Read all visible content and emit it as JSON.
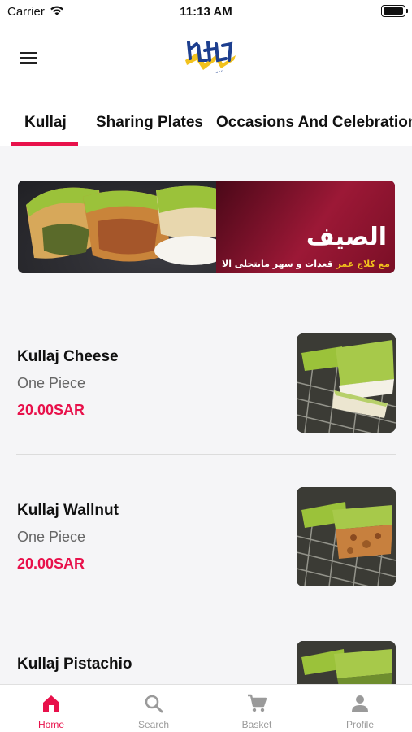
{
  "status_bar": {
    "carrier": "Carrier",
    "time": "11:13 AM"
  },
  "header": {
    "logo_alt": "كلاج عمر"
  },
  "tabs": [
    {
      "label": "Kullaj",
      "active": true
    },
    {
      "label": "Sharing Plates"
    },
    {
      "label": "Occasions And Celebrations"
    }
  ],
  "banner": {
    "title": "الصيف",
    "subtitle": "قعدات و سهر مايتحلى الا",
    "subtitle_highlight": "مع كلاج عمر"
  },
  "products": [
    {
      "name": "Kullaj Cheese",
      "description": "One Piece",
      "price": "20.00SAR"
    },
    {
      "name": "Kullaj Wallnut",
      "description": "One Piece",
      "price": "20.00SAR"
    },
    {
      "name": "Kullaj Pistachio"
    }
  ],
  "bottom_nav": [
    {
      "label": "Home",
      "icon": "home-icon",
      "active": true
    },
    {
      "label": "Search",
      "icon": "search-icon"
    },
    {
      "label": "Basket",
      "icon": "cart-icon"
    },
    {
      "label": "Profile",
      "icon": "person-icon"
    }
  ],
  "colors": {
    "accent": "#e8114b",
    "banner_red": "#9c1836",
    "pistachio": "#9bc23a"
  }
}
